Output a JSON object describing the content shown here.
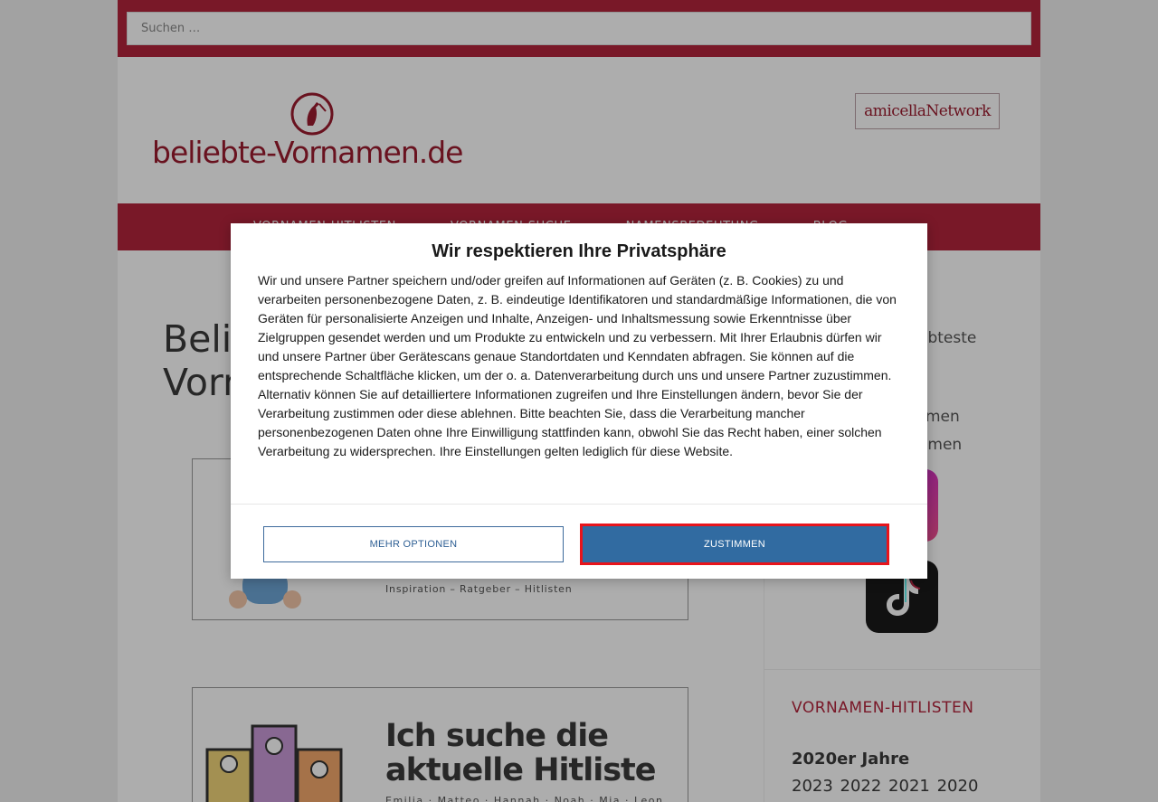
{
  "search": {
    "placeholder": "Suchen …"
  },
  "header": {
    "logo_text": "beliebte-Vornamen.de",
    "network_badge": "amicellaNetwork"
  },
  "nav": {
    "items": [
      "VORNAMEN-HITLISTEN",
      "VORNAMEN-SUCHE",
      "NAMENSBEDEUTUNG",
      "BLOG"
    ]
  },
  "main": {
    "title_line1": "Beli",
    "title_line2": "Vorn",
    "banner1_tagline": "Inspiration – Ratgeber – Hitlisten",
    "banner2_heading_line1": "Ich suche die",
    "banner2_heading_line2": "aktuelle Hitliste",
    "banner2_names": "Emilia · Matteo · Hannah · Noah · Mia · Leon"
  },
  "sidebar": {
    "line1": "ebteste",
    "line2": "men",
    "line3": "amen",
    "hitlisten_heading": "VORNAMEN-HITLISTEN",
    "decade": "2020er Jahre",
    "years": "2023 2022 2021 2020"
  },
  "consent": {
    "title": "Wir respektieren Ihre Privatsphäre",
    "body": "Wir und unsere Partner speichern und/oder greifen auf Informationen auf Geräten (z. B. Cookies) zu und verarbeiten personenbezogene Daten, z. B. eindeutige Identifikatoren und standardmäßige Informationen, die von Geräten für personalisierte Anzeigen und Inhalte, Anzeigen- und Inhaltsmessung sowie Erkenntnisse über Zielgruppen gesendet werden und um Produkte zu entwickeln und zu verbessern. Mit Ihrer Erlaubnis dürfen wir und unsere Partner über Gerätescans genaue Standortdaten und Kenndaten abfragen. Sie können auf die entsprechende Schaltfläche klicken, um der o. a. Datenverarbeitung durch uns und unsere Partner zuzustimmen. Alternativ können Sie auf detailliertere Informationen zugreifen und Ihre Einstellungen ändern, bevor Sie der Verarbeitung zustimmen oder diese ablehnen. Bitte beachten Sie, dass die Verarbeitung mancher personenbezogenen Daten ohne Ihre Einwilligung stattfinden kann, obwohl Sie das Recht haben, einer solchen Verarbeitung zu widersprechen. Ihre Einstellungen gelten lediglich für diese Website.",
    "more_options_label": "MEHR OPTIONEN",
    "agree_label": "ZUSTIMMEN"
  },
  "colors": {
    "brand_red": "#b3243c",
    "button_blue": "#316ba1",
    "highlight_red": "#e8141b"
  },
  "icons": [
    "stork-logo-icon",
    "instagram-icon",
    "tiktok-icon",
    "podium-icon"
  ]
}
